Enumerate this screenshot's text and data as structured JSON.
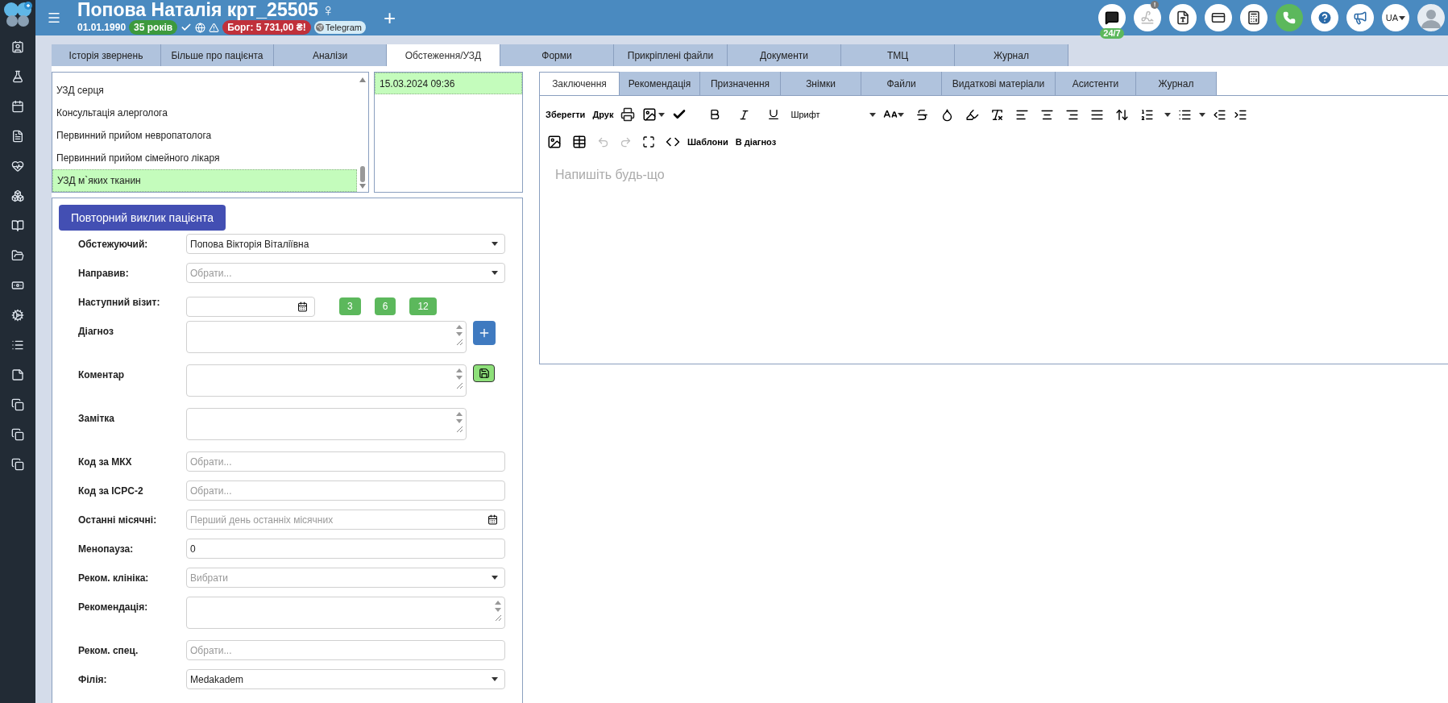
{
  "header": {
    "title": "Попова Наталія крт_25505",
    "gender": "♀",
    "birth_date": "01.01.1990",
    "age": "35 років",
    "debt": "Борг: 5 731,00 ₴!",
    "messenger": "Telegram",
    "add": "+",
    "chat_badge": "24/7",
    "notice_badge": "!",
    "language": "UA"
  },
  "main_tabs": [
    {
      "label": "Історія звернень",
      "selected": false
    },
    {
      "label": "Більше про пацієнта",
      "selected": false
    },
    {
      "label": "Аналізи",
      "selected": false
    },
    {
      "label": "Обстеження/УЗД",
      "selected": true
    },
    {
      "label": "Форми",
      "selected": false
    },
    {
      "label": "Прикріплені файли",
      "selected": false
    },
    {
      "label": "Документи",
      "selected": false
    },
    {
      "label": "ТМЦ",
      "selected": false
    },
    {
      "label": "Журнал",
      "selected": false
    }
  ],
  "exam_list": [
    {
      "label": "УЗД серця",
      "selected": false
    },
    {
      "label": "Консультація алерголога",
      "selected": false
    },
    {
      "label": "Первинний прийом невропатолога",
      "selected": false
    },
    {
      "label": "Первинний прийом сімейного лікаря",
      "selected": false
    },
    {
      "label": "УЗД м`яких тканин",
      "selected": true
    }
  ],
  "dates": [
    {
      "label": "15.03.2024 09:36",
      "selected": true
    }
  ],
  "recall_button": "Повторний виклик пацієнта",
  "form": [
    {
      "kind": "select",
      "label": "Обстежуючий:",
      "value": "Попова Вікторія Віталіївна"
    },
    {
      "kind": "select",
      "label": "Направив:",
      "placeholder": "Обрати..."
    },
    {
      "kind": "visit",
      "label": "Наступний візит:",
      "buttons": [
        "3",
        "6",
        "12"
      ]
    },
    {
      "kind": "textarea",
      "label": "Діагноз",
      "button": {
        "kind": "add"
      }
    },
    {
      "kind": "textarea",
      "label": "Коментар",
      "button": {
        "kind": "save"
      }
    },
    {
      "kind": "textarea",
      "label": "Замітка"
    },
    {
      "kind": "input",
      "label": "Код за МКХ",
      "placeholder": "Обрати..."
    },
    {
      "kind": "input",
      "label": "Код за ICPC-2",
      "placeholder": "Обрати..."
    },
    {
      "kind": "date",
      "label": "Останні місячні:",
      "placeholder": "Перший день останніх місячних"
    },
    {
      "kind": "input",
      "label": "Менопауза:",
      "value": "0"
    },
    {
      "kind": "select",
      "label": "Реком. клініка:",
      "placeholder": "Вибрати"
    },
    {
      "kind": "widetext",
      "label": "Рекомендація:"
    },
    {
      "kind": "input",
      "label": "Реком. спец.",
      "placeholder": "Обрати..."
    },
    {
      "kind": "select",
      "label": "Філія:",
      "value": "Medakadem"
    }
  ],
  "editor_tabs": [
    {
      "label": "Заключення",
      "selected": true
    },
    {
      "label": "Рекомендація",
      "selected": false
    },
    {
      "label": "Призначення",
      "selected": false
    },
    {
      "label": "Знімки",
      "selected": false
    },
    {
      "label": "Файли",
      "selected": false
    },
    {
      "label": "Видаткові матеріали",
      "selected": false
    },
    {
      "label": "Асистенти",
      "selected": false
    },
    {
      "label": "Журнал",
      "selected": false
    }
  ],
  "toolbar": [
    "Зберегти",
    "Друк",
    "Шрифт",
    "Шаблони",
    "В діагноз"
  ],
  "editor": {
    "placeholder": "Напишіть будь-що"
  }
}
